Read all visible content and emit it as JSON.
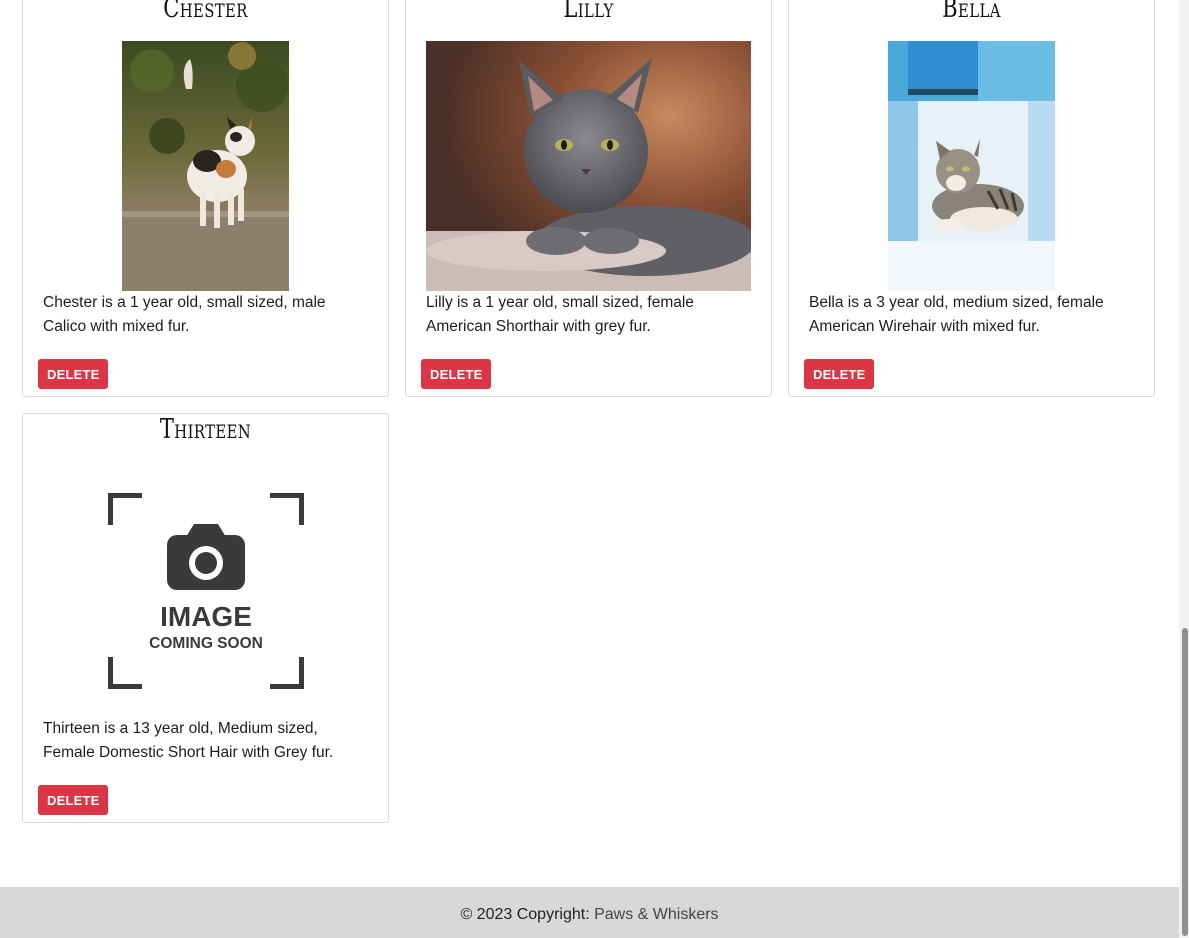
{
  "cards": [
    {
      "name": "Chester",
      "description": "Chester is a 1 year old, small sized, male Calico with mixed fur.",
      "image_alt": "calico cat photo",
      "delete_label": "DELETE"
    },
    {
      "name": "Lilly",
      "description": "Lilly is a 1 year old, small sized, female American Shorthair with grey fur.",
      "image_alt": "grey kitten photo",
      "delete_label": "DELETE"
    },
    {
      "name": "Bella",
      "description": "Bella is a 3 year old, medium sized, female American Wirehair with mixed fur.",
      "image_alt": "tabby cat photo",
      "delete_label": "DELETE"
    },
    {
      "name": "Thirteen",
      "description": "Thirteen is a 13 year old, Medium sized, Female Domestic Short Hair with Grey fur.",
      "placeholder_line1": "IMAGE",
      "placeholder_line2": "COMING SOON",
      "delete_label": "DELETE"
    }
  ],
  "footer": {
    "copyright": "© 2023 Copyright: ",
    "brand": "Paws & Whiskers"
  },
  "colors": {
    "delete_button": "#dc3545",
    "footer_bg": "#d8d8d8"
  }
}
